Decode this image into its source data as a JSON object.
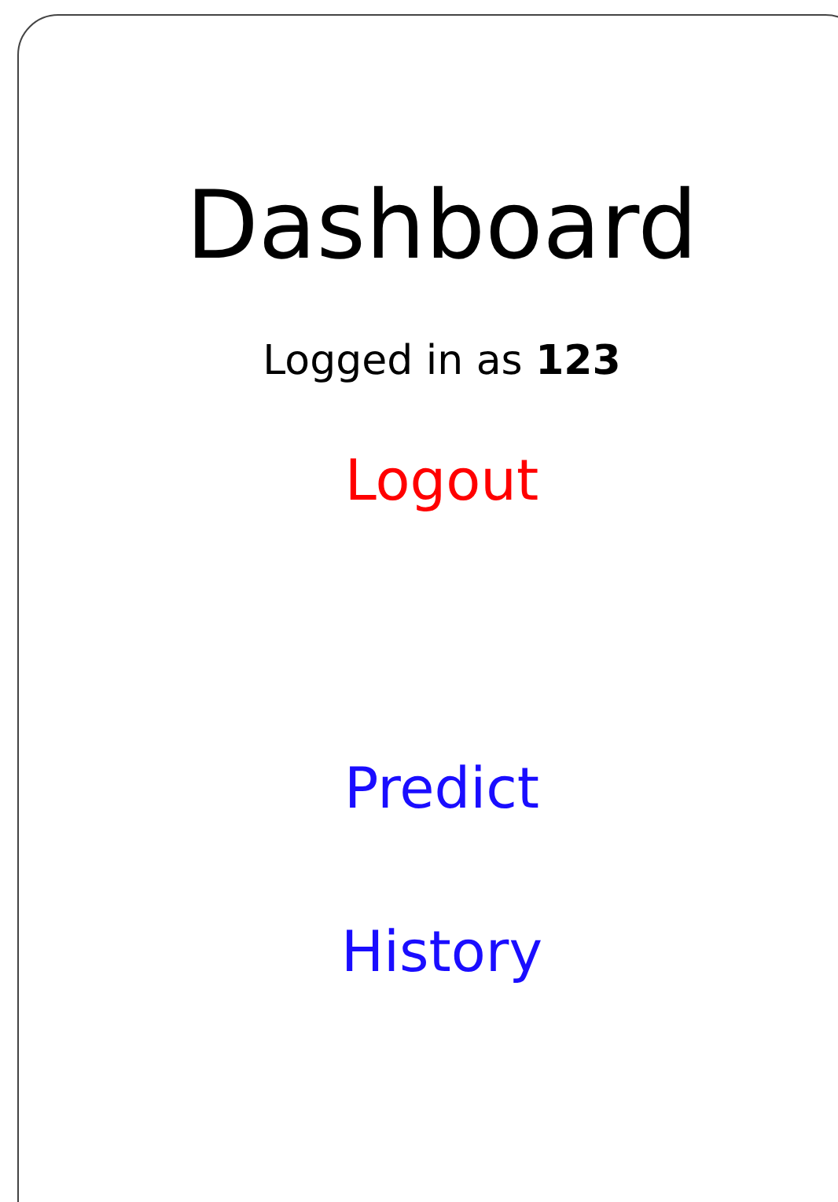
{
  "title": "Dashboard",
  "user_line": "Logged in as **123**",
  "links": [
    {
      "label": "Logout",
      "kind": "danger"
    },
    {
      "label": "Predict",
      "kind": "nav"
    },
    {
      "label": "History",
      "kind": "nav"
    }
  ]
}
